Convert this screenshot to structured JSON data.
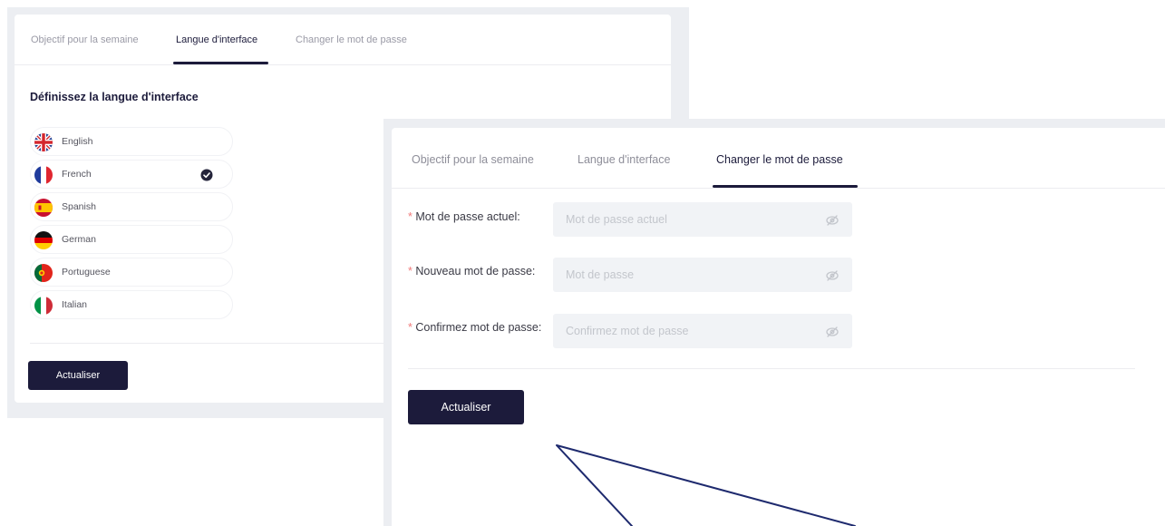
{
  "left_panel": {
    "tabs": [
      {
        "label": "Objectif pour la semaine"
      },
      {
        "label": "Langue d'interface"
      },
      {
        "label": "Changer le mot de passe"
      }
    ],
    "active_tab": "Langue d'interface",
    "heading": "Définissez la langue d'interface",
    "languages": [
      {
        "label": "English",
        "flag": "uk-flag-icon"
      },
      {
        "label": "French",
        "flag": "france-flag-icon",
        "selected": true
      },
      {
        "label": "Spanish",
        "flag": "spain-flag-icon"
      },
      {
        "label": "German",
        "flag": "germany-flag-icon"
      },
      {
        "label": "Portuguese",
        "flag": "portugal-flag-icon"
      },
      {
        "label": "Italian",
        "flag": "italy-flag-icon"
      }
    ],
    "submit_label": "Actualiser"
  },
  "right_panel": {
    "tabs": [
      {
        "label": "Objectif pour la semaine"
      },
      {
        "label": "Langue d'interface"
      },
      {
        "label": "Changer le mot de passe"
      }
    ],
    "active_tab": "Changer le mot de passe",
    "fields": [
      {
        "required_mark": "*",
        "label": "Mot de passe actuel",
        "colon": ":",
        "placeholder": "Mot de passe actuel",
        "value": ""
      },
      {
        "required_mark": "*",
        "label": "Nouveau mot de passe",
        "colon": ":",
        "placeholder": "Mot de passe",
        "value": ""
      },
      {
        "required_mark": "*",
        "label": "Confirmez mot de passe",
        "colon": ":",
        "placeholder": "Confirmez mot de passe",
        "value": ""
      }
    ],
    "submit_label": "Actualiser"
  },
  "colors": {
    "primary": "#1c1b3b",
    "required": "#f07a7a",
    "input_bg": "#f1f3f6",
    "muted_text": "#9a9aa6",
    "callout_line": "#1e2a6e"
  }
}
